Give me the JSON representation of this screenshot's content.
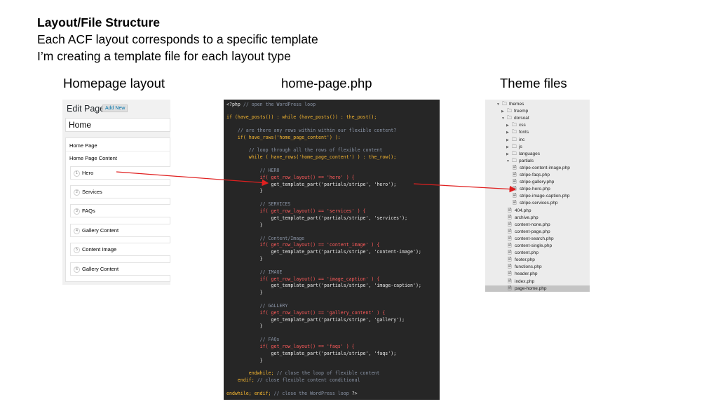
{
  "slide": {
    "title": "Layout/File Structure",
    "line1": "Each ACF layout corresponds to a specific template",
    "line2": "I’m creating a template file for each layout type"
  },
  "labels": {
    "homepage": "Homepage layout",
    "code": "home-page.php",
    "theme": "Theme files"
  },
  "acf": {
    "page_heading": "Edit Page",
    "add_new": "Add New",
    "title_value": "Home",
    "box_title": "Home Page",
    "field_label": "Home Page Content",
    "rows": [
      {
        "num": "1",
        "label": "Hero"
      },
      {
        "num": "2",
        "label": "Services"
      },
      {
        "num": "3",
        "label": "FAQs"
      },
      {
        "num": "4",
        "label": "Gallery Content"
      },
      {
        "num": "5",
        "label": "Content Image"
      },
      {
        "num": "6",
        "label": "Gallery Content"
      }
    ]
  },
  "code": {
    "open_tag": "<?php",
    "c_open_loop": "// open the WordPress loop",
    "if_posts": "if (have_posts()) : while (have_posts()) : the_post();",
    "c_rows": "// are there any rows within within our flexible content?",
    "if_rows": "if( have_rows('home_page_content') ):",
    "c_loop": "// loop through all the rows of flexible content",
    "while_rows": "while ( have_rows('home_page_content') ) : the_row();",
    "c_hero": "// HERO",
    "if_hero": "if( get_row_layout() == 'hero' ) {",
    "tpl_hero": "get_template_part('partials/stripe', 'hero');",
    "close1": "}",
    "c_services": "// SERVICES",
    "if_services": "if( get_row_layout() == 'services' ) {",
    "tpl_services": "get_template_part('partials/stripe', 'services');",
    "close2": "}",
    "c_content_image": "// Content/Image",
    "if_content_image": "if( get_row_layout() == 'content_image' ) {",
    "tpl_content_image": "get_template_part('partials/stripe', 'content-image');",
    "close3": "}",
    "c_image": "// IMAGE",
    "if_image": "if( get_row_layout() == 'image_caption' ) {",
    "tpl_image": "get_template_part('partials/stripe', 'image-caption');",
    "close4": "}",
    "c_gallery": "// GALLERY",
    "if_gallery": "if( get_row_layout() == 'gallery_content' ) {",
    "tpl_gallery": "get_template_part('partials/stripe', 'gallery');",
    "close5": "}",
    "c_faqs": "// FAQs",
    "if_faqs": "if( get_row_layout() == 'faqs' ) {",
    "tpl_faqs": "get_template_part('partials/stripe', 'faqs');",
    "close6": "}",
    "endwhile_inner": "endwhile;",
    "c_close_loop": "// close the loop of flexible content",
    "endif_inner": "endif;",
    "c_close_cond": "// close flexible content conditional",
    "endwhile_outer": "endwhile; endif;",
    "c_close_wp": "// close the WordPress loop",
    "close_tag": "?>"
  },
  "tree": [
    {
      "label": "themes",
      "type": "folder",
      "arrow": "▼"
    },
    {
      "label": "freemp",
      "type": "folder",
      "arrow": "▶"
    },
    {
      "label": "dorsoat",
      "type": "folder",
      "arrow": "▼"
    },
    {
      "label": "css",
      "type": "folder",
      "arrow": "▶"
    },
    {
      "label": "fonts",
      "type": "folder",
      "arrow": "▶"
    },
    {
      "label": "inc",
      "type": "folder",
      "arrow": "▶"
    },
    {
      "label": "js",
      "type": "folder",
      "arrow": "▶"
    },
    {
      "label": "languages",
      "type": "folder",
      "arrow": "▶"
    },
    {
      "label": "partials",
      "type": "folder",
      "arrow": "▼"
    },
    {
      "label": "stripe-content-image.php",
      "type": "file"
    },
    {
      "label": "stripe-faqs.php",
      "type": "file"
    },
    {
      "label": "stripe-gallery.php",
      "type": "file"
    },
    {
      "label": "stripe-hero.php",
      "type": "file"
    },
    {
      "label": "stripe-image-caption.php",
      "type": "file"
    },
    {
      "label": "stripe-services.php",
      "type": "file"
    },
    {
      "label": "404.php",
      "type": "file"
    },
    {
      "label": "archive.php",
      "type": "file"
    },
    {
      "label": "content-none.php",
      "type": "file"
    },
    {
      "label": "content-page.php",
      "type": "file"
    },
    {
      "label": "content-search.php",
      "type": "file"
    },
    {
      "label": "content-single.php",
      "type": "file"
    },
    {
      "label": "content.php",
      "type": "file"
    },
    {
      "label": "footer.php",
      "type": "file"
    },
    {
      "label": "functions.php",
      "type": "file"
    },
    {
      "label": "header.php",
      "type": "file"
    },
    {
      "label": "index.php",
      "type": "file"
    },
    {
      "label": "page-home.php",
      "type": "file"
    }
  ],
  "colors": {
    "code_bg": "#262626",
    "keyword": "#f8b830",
    "keyword_red": "#ff5a5a",
    "comment": "#8a94a6",
    "arrow": "#e02020"
  }
}
